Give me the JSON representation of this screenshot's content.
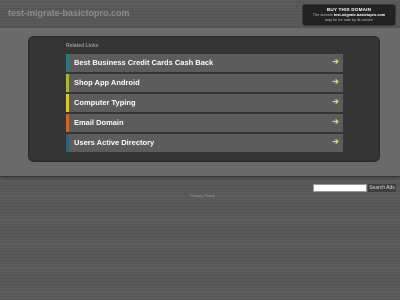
{
  "header": {
    "site_title": "test-migrate-basictopro.com"
  },
  "buy_box": {
    "title": "BUY THIS DOMAIN",
    "line1_prefix": "The domain ",
    "line1_domain": "test-migrate-basictopro.com",
    "line2": "may be for sale by its owner!"
  },
  "main": {
    "section_title": "Related Links",
    "links": [
      {
        "label": "Best Business Credit Cards Cash Back",
        "arrow": "➔",
        "stripe_color": "#2e7a78"
      },
      {
        "label": "Shop App Android",
        "arrow": "➔",
        "stripe_color": "#a8b83a"
      },
      {
        "label": "Computer Typing",
        "arrow": "➔",
        "stripe_color": "#d8c838"
      },
      {
        "label": "Email Domain",
        "arrow": "➔",
        "stripe_color": "#c86a28"
      },
      {
        "label": "Users Active Directory",
        "arrow": "➔",
        "stripe_color": "#2e5e7a"
      }
    ]
  },
  "search": {
    "input_value": "",
    "button_label": "Search Ads"
  },
  "footer": {
    "privacy_label": "Privacy Policy"
  }
}
